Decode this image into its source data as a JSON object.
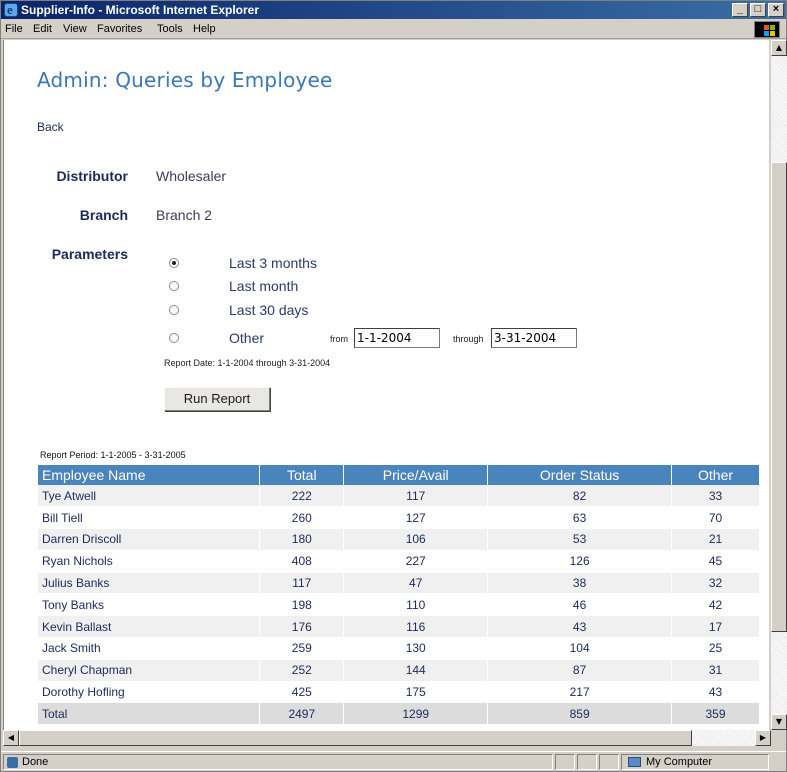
{
  "window": {
    "title": "Supplier-Info - Microsoft Internet Explorer",
    "minimize": "_",
    "maximize": "□",
    "close": "×"
  },
  "menu": [
    "File",
    "Edit",
    "View",
    "Favorites",
    "Tools",
    "Help"
  ],
  "page": {
    "title": "Admin: Queries by Employee",
    "back": "Back",
    "distributor_label": "Distributor",
    "distributor_value": "Wholesaler",
    "branch_label": "Branch",
    "branch_value": "Branch 2",
    "parameters_label": "Parameters",
    "options": [
      {
        "label": "Last 3 months",
        "checked": true
      },
      {
        "label": "Last month",
        "checked": false
      },
      {
        "label": "Last 30 days",
        "checked": false
      },
      {
        "label": "Other",
        "checked": false
      }
    ],
    "from_label": "from",
    "from_value": "1-1-2004",
    "through_label": "through",
    "through_value": "3-31-2004",
    "report_date": "Report Date: 1-1-2004 through 3-31-2004",
    "run_button": "Run Report",
    "report_period": "Report Period: 1-1-2005 - 3-31-2005"
  },
  "table": {
    "headers": [
      "Employee Name",
      "Total",
      "Price/Avail",
      "Order Status",
      "Other"
    ],
    "rows": [
      [
        "Tye Atwell",
        "222",
        "117",
        "82",
        "33"
      ],
      [
        "Bill Tiell",
        "260",
        "127",
        "63",
        "70"
      ],
      [
        "Darren Driscoll",
        "180",
        "106",
        "53",
        "21"
      ],
      [
        "Ryan Nichols",
        "408",
        "227",
        "126",
        "45"
      ],
      [
        "Julius Banks",
        "117",
        "47",
        "38",
        "32"
      ],
      [
        "Tony Banks",
        "198",
        "110",
        "46",
        "42"
      ],
      [
        "Kevin Ballast",
        "176",
        "116",
        "43",
        "17"
      ],
      [
        "Jack Smith",
        "259",
        "130",
        "104",
        "25"
      ],
      [
        "Cheryl Chapman",
        "252",
        "144",
        "87",
        "31"
      ],
      [
        "Dorothy Hofling",
        "425",
        "175",
        "217",
        "43"
      ]
    ],
    "total": [
      "Total",
      "2497",
      "1299",
      "859",
      "359"
    ]
  },
  "status": {
    "text": "Done",
    "zone": "My Computer"
  },
  "colors": {
    "title_blue": "#3a78b8",
    "header_blue": "#4a84bd",
    "label_navy": "#1c2a5c"
  }
}
